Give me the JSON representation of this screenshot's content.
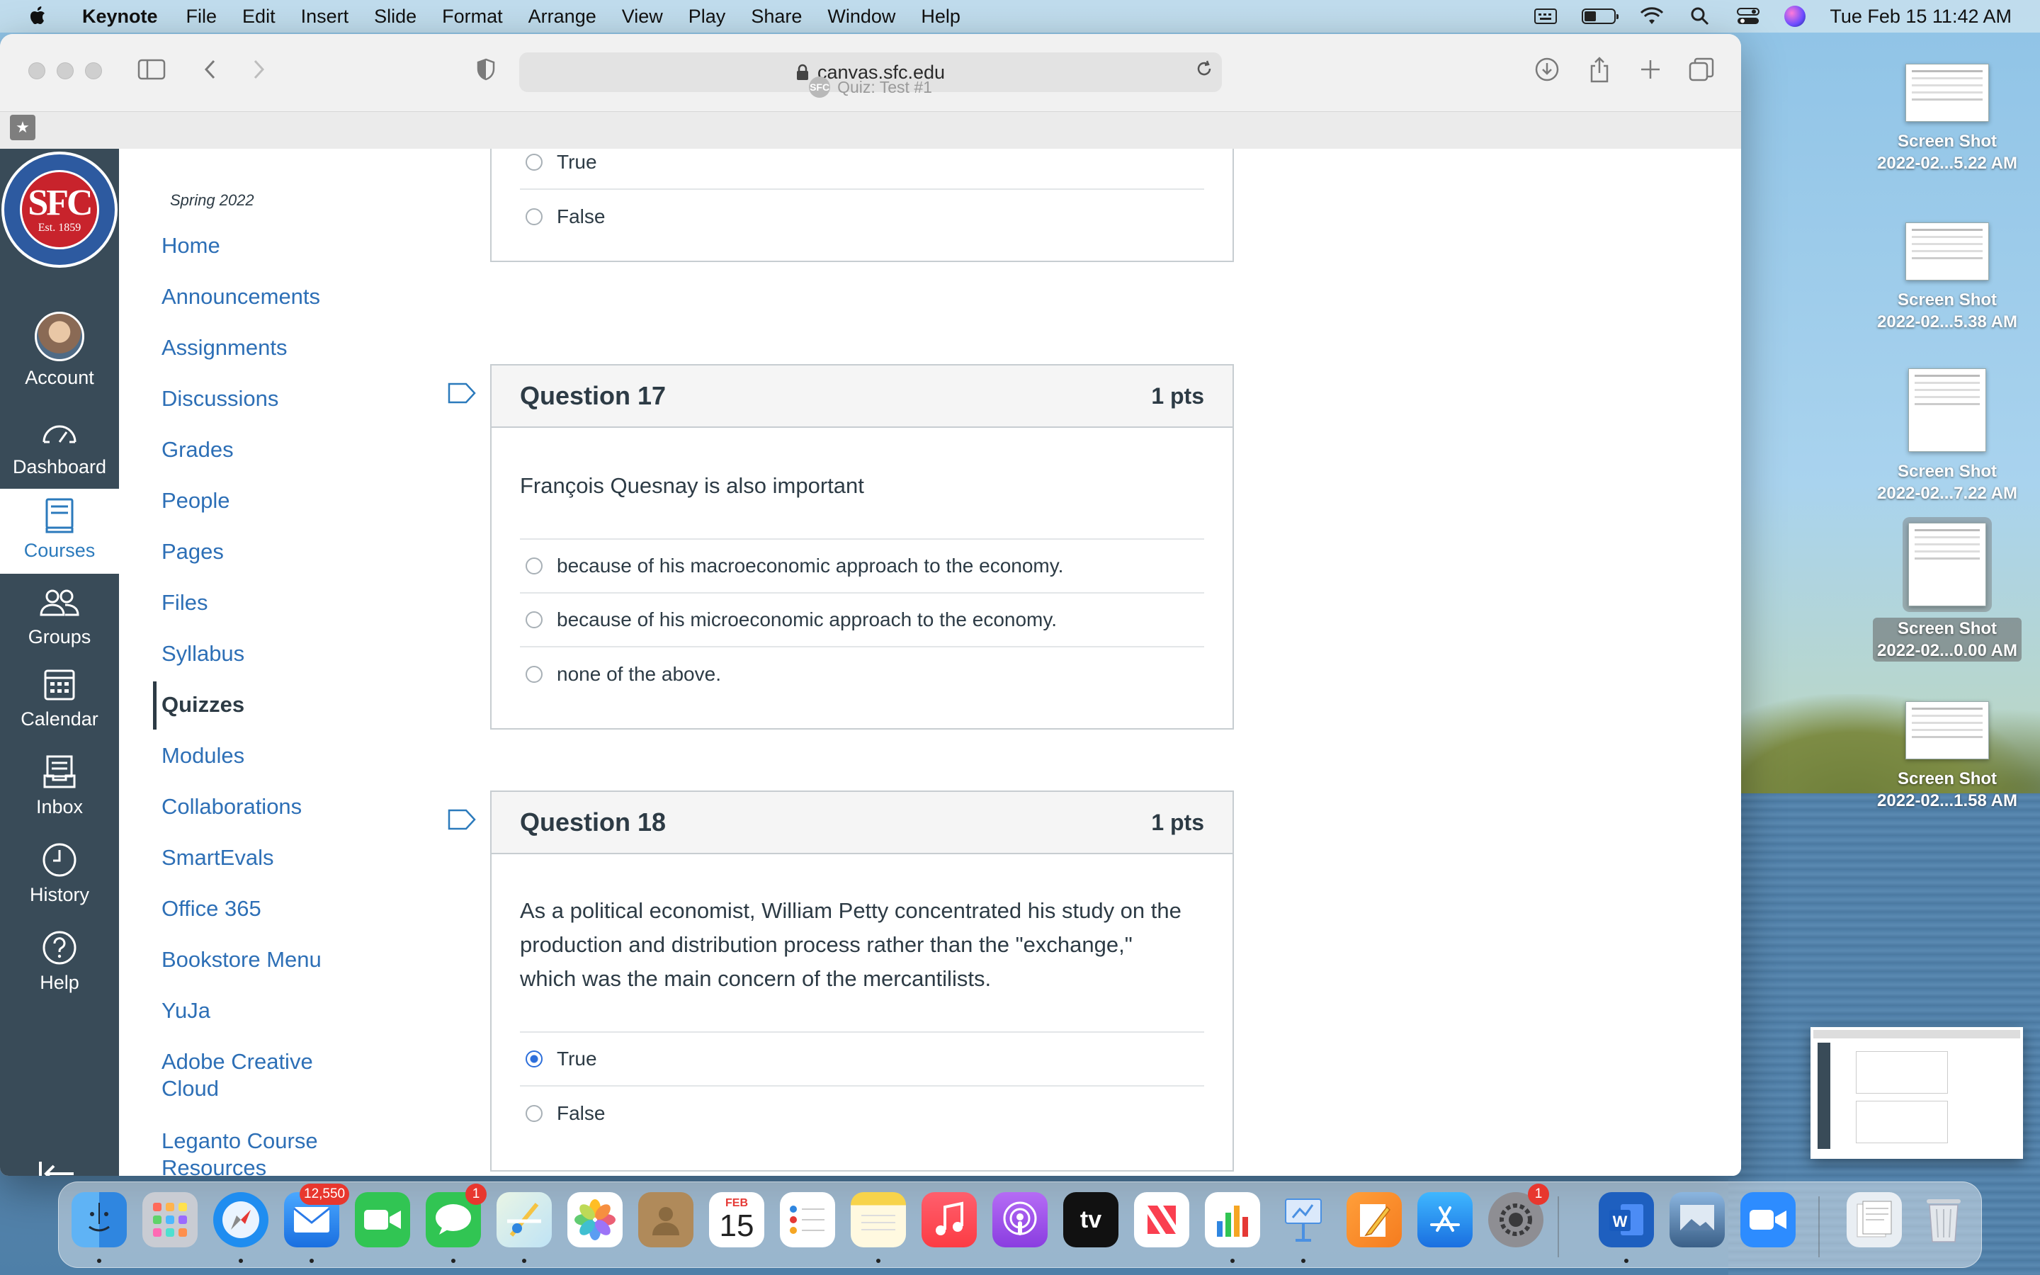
{
  "menubar": {
    "app": "Keynote",
    "menus": [
      "File",
      "Edit",
      "Insert",
      "Slide",
      "Format",
      "Arrange",
      "View",
      "Play",
      "Share",
      "Window",
      "Help"
    ],
    "datetime": "Tue Feb 15  11:42 AM"
  },
  "browser": {
    "url": "canvas.sfc.edu",
    "tab_title": "Quiz: Test #1",
    "favicon_text": "SFC"
  },
  "logo": {
    "mark": "SFC",
    "est": "Est. 1859"
  },
  "global_nav": [
    {
      "label": "Account"
    },
    {
      "label": "Dashboard"
    },
    {
      "label": "Courses"
    },
    {
      "label": "Groups"
    },
    {
      "label": "Calendar"
    },
    {
      "label": "Inbox"
    },
    {
      "label": "History"
    },
    {
      "label": "Help"
    }
  ],
  "course_nav": {
    "term": "Spring 2022",
    "items": [
      "Home",
      "Announcements",
      "Assignments",
      "Discussions",
      "Grades",
      "People",
      "Pages",
      "Files",
      "Syllabus",
      "Quizzes",
      "Modules",
      "Collaborations",
      "SmartEvals",
      "Office 365",
      "Bookstore Menu",
      "YuJa",
      "Adobe Creative",
      "Cloud",
      "Leganto Course",
      "Resources"
    ],
    "active": "Quizzes"
  },
  "quiz": {
    "prev_answers": [
      "True",
      "False"
    ],
    "q17": {
      "title": "Question 17",
      "pts": "1 pts",
      "text": "François Quesnay is also important",
      "answers": [
        "because of his macroeconomic approach to the economy.",
        "because of his microeconomic approach to the economy.",
        "none of the above."
      ]
    },
    "q18": {
      "title": "Question 18",
      "pts": "1 pts",
      "text_lines": [
        "As a political economist, William Petty concentrated his study on the",
        "production and distribution process rather than the \"exchange,\"",
        "which was the main concern of the mercantilists."
      ],
      "answers": [
        "True",
        "False"
      ],
      "selected": "True"
    }
  },
  "desktop_files": [
    {
      "line1": "Screen Shot",
      "line2": "2022-02...5.22 AM"
    },
    {
      "line1": "Screen Shot",
      "line2": "2022-02...5.38 AM"
    },
    {
      "line1": "Screen Shot",
      "line2": "2022-02...7.22 AM"
    },
    {
      "line1": "Screen Shot",
      "line2": "2022-02...0.00 AM"
    },
    {
      "line1": "Screen Shot",
      "line2": "2022-02...1.58 AM"
    }
  ],
  "dock": {
    "mail_badge": "12,550",
    "messages_badge": "1",
    "settings_badge": "1",
    "calendar_month": "FEB",
    "calendar_day": "15",
    "tv_label": "tv"
  },
  "colors": {
    "canvas_nav": "#394b58",
    "link": "#2d6fb6",
    "text": "#2d3b45",
    "selected_radio": "#2d6fdb"
  }
}
